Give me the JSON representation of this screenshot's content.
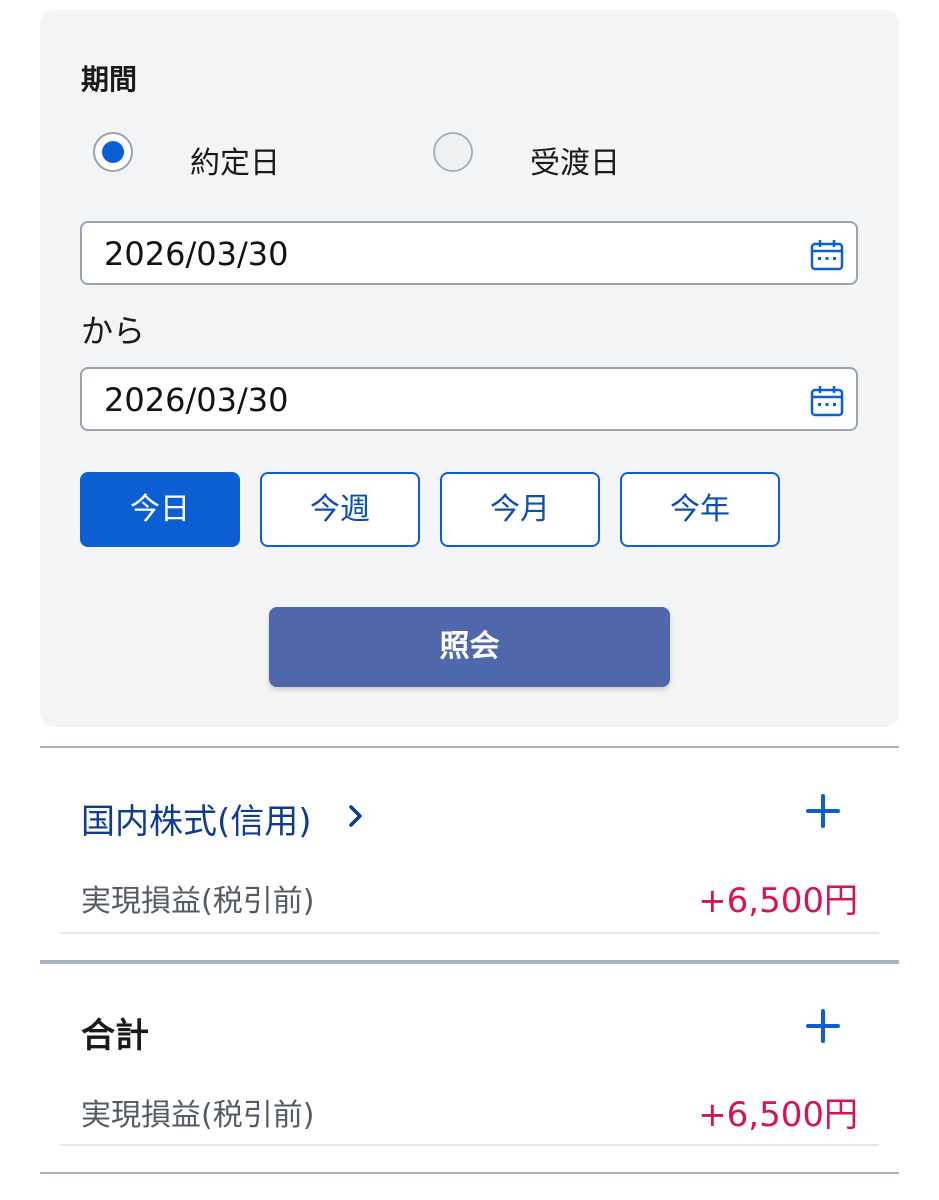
{
  "filter": {
    "period_label": "期間",
    "date_type_options": [
      {
        "label": "約定日",
        "selected": true
      },
      {
        "label": "受渡日",
        "selected": false
      }
    ],
    "from_date": "2026/03/30",
    "from_suffix": "から",
    "to_date": "2026/03/30",
    "range_buttons": [
      {
        "label": "今日",
        "active": true
      },
      {
        "label": "今週",
        "active": false
      },
      {
        "label": "今月",
        "active": false
      },
      {
        "label": "今年",
        "active": false
      }
    ],
    "query_button": "照会"
  },
  "sections": [
    {
      "title": "国内株式(信用)",
      "row_label": "実現損益(税引前)",
      "row_value": "+6,500円"
    },
    {
      "title": "合計",
      "row_label": "実現損益(税引前)",
      "row_value": "+6,500円"
    }
  ],
  "colors": {
    "accent": "#0b5fd3",
    "query_button": "#5068ab",
    "positive_value": "#d6125b",
    "link_text": "#0d3d8c"
  },
  "icons": {
    "calendar": "calendar-icon",
    "chevron": "chevron-right-icon",
    "expand": "plus-icon"
  }
}
